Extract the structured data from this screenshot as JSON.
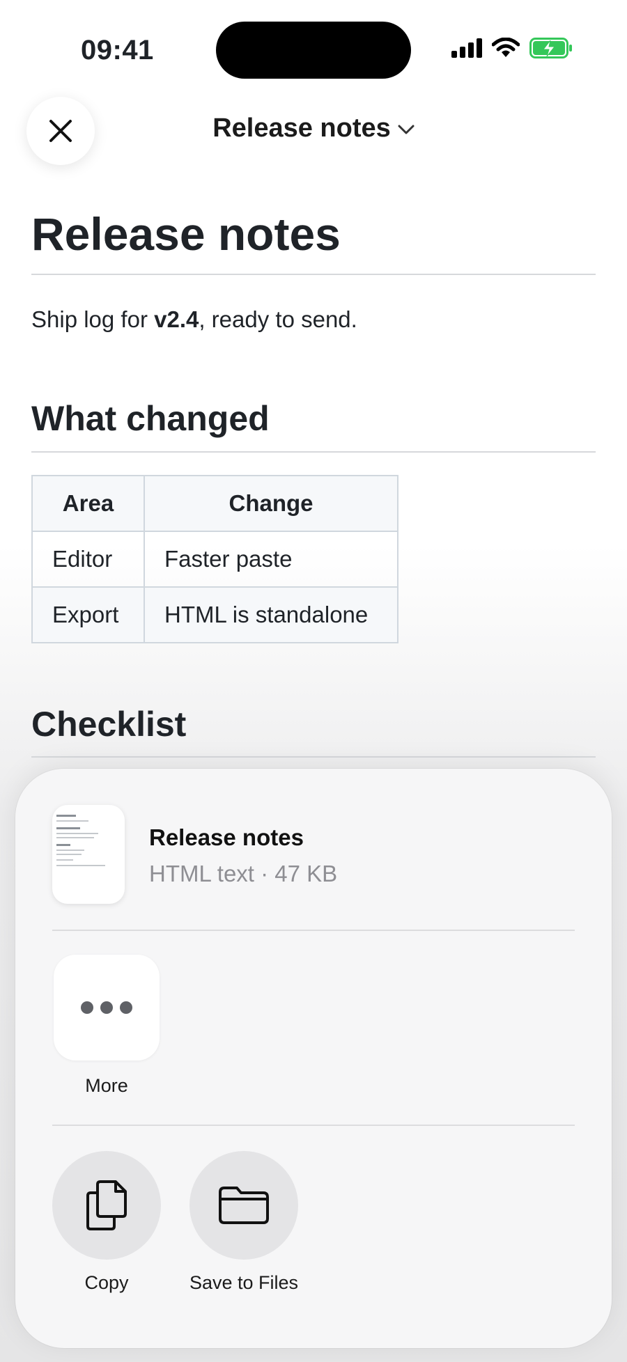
{
  "status": {
    "time": "09:41"
  },
  "nav": {
    "title": "Release notes"
  },
  "doc": {
    "title": "Release notes",
    "intro_prefix": "Ship log for ",
    "intro_version": "v2.4",
    "intro_suffix": ", ready to send.",
    "section_changes": "What changed",
    "table": {
      "headers": [
        "Area",
        "Change"
      ],
      "rows": [
        [
          "Editor",
          "Faster paste"
        ],
        [
          "Export",
          "HTML is standalone"
        ]
      ]
    },
    "section_checklist": "Checklist"
  },
  "share": {
    "file_name": "Release notes",
    "file_meta": "HTML text · 47 KB",
    "more_label": "More",
    "copy_label": "Copy",
    "save_label": "Save to Files"
  },
  "icons": {
    "close": "close-icon",
    "chevron": "chevron-down-icon",
    "more": "more-dots-icon",
    "copy": "copy-icon",
    "folder": "folder-icon"
  },
  "colors": {
    "battery": "#34c759",
    "text": "#1f2328"
  }
}
